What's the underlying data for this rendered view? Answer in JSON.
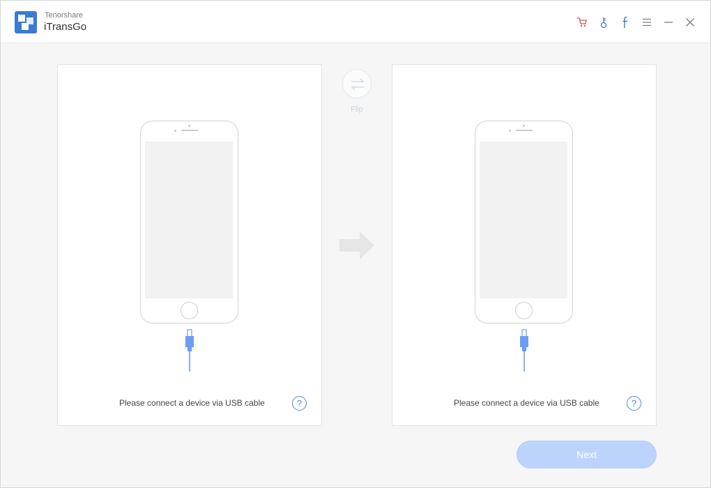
{
  "app": {
    "brand_small": "Tenorshare",
    "brand_name": "iTransGo"
  },
  "toolbar": {
    "icons": [
      "cart-icon",
      "key-icon",
      "facebook-icon",
      "menu-icon",
      "minimize-icon",
      "close-icon"
    ],
    "cart_color": "#e04a5a",
    "accent_color": "#3a7bd5"
  },
  "source_panel": {
    "message": "Please connect a device via USB cable",
    "help_label": "?"
  },
  "target_panel": {
    "message": "Please connect a device via USB cable",
    "help_label": "?"
  },
  "flip": {
    "label": "Flip"
  },
  "actions": {
    "next_label": "Next",
    "next_color": "#bcd4fb"
  }
}
